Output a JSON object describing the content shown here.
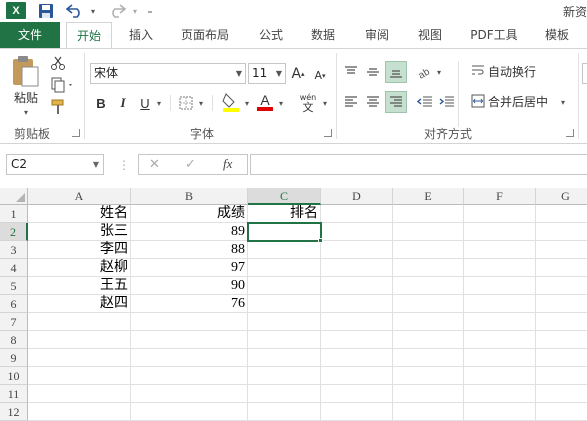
{
  "app": {
    "logo_letter": "X",
    "title_partial": "新资",
    "accent_color": "#217346"
  },
  "quick_access": {
    "save_icon": "save-icon",
    "undo_icon": "undo-icon",
    "redo_icon": "redo-icon"
  },
  "tabs": [
    {
      "label": "文件"
    },
    {
      "label": "开始"
    },
    {
      "label": "插入"
    },
    {
      "label": "页面布局"
    },
    {
      "label": "公式"
    },
    {
      "label": "数据"
    },
    {
      "label": "审阅"
    },
    {
      "label": "视图"
    },
    {
      "label": "PDF工具"
    },
    {
      "label": "模板"
    }
  ],
  "ribbon": {
    "clipboard": {
      "label": "剪贴板",
      "paste_label": "粘贴"
    },
    "font": {
      "label": "字体",
      "font_name": "宋体",
      "font_size": "11",
      "bold": "B",
      "italic": "I",
      "underline": "U",
      "grow": "A",
      "shrink": "A",
      "font_color_letter": "A",
      "phonetic_top": "wén",
      "phonetic_bottom": "文"
    },
    "alignment": {
      "label": "对齐方式",
      "wrap_text": "自动换行",
      "merge_center": "合并后居中"
    }
  },
  "formula_bar": {
    "name_box": "C2",
    "fx": "fx",
    "cancel": "✕",
    "enter": "✓",
    "value": ""
  },
  "sheet": {
    "columns": [
      "A",
      "B",
      "C",
      "D",
      "E",
      "F",
      "G"
    ],
    "rows": [
      "1",
      "2",
      "3",
      "4",
      "5",
      "6",
      "7",
      "8",
      "9",
      "10",
      "11",
      "12"
    ],
    "cells": {
      "A1": "姓名",
      "B1": "成绩",
      "C1": "排名",
      "A2": "张三",
      "B2": "89",
      "A3": "李四",
      "B3": "88",
      "A4": "赵柳",
      "B4": "97",
      "A5": "王五",
      "B5": "90",
      "A6": "赵四",
      "B6": "76"
    },
    "active_cell": "C2"
  }
}
